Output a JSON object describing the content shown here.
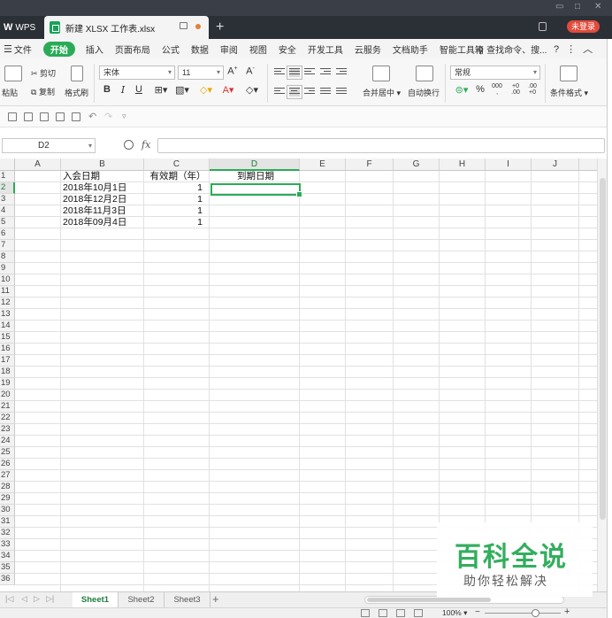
{
  "titlebar": {
    "app_label": "WPS",
    "doc_tab_title": "新建 XLSX 工作表.xlsx",
    "login_label": "未登录"
  },
  "menu": {
    "file": "文件",
    "items": [
      "开始",
      "插入",
      "页面布局",
      "公式",
      "数据",
      "审阅",
      "视图",
      "安全",
      "开发工具",
      "云服务",
      "文档助手",
      "智能工具箱"
    ],
    "search": "查找命令、搜..."
  },
  "ribbon": {
    "paste": "粘贴",
    "cut": "剪切",
    "copy": "复制",
    "format_painter": "格式刷",
    "font_name": "宋体",
    "font_size": "11",
    "merge": "合并居中",
    "wrap": "自动换行",
    "number_format": "常规",
    "cond_format": "条件格式"
  },
  "formula_bar": {
    "name_box": "D2",
    "fx": "fx",
    "formula": ""
  },
  "grid": {
    "columns": [
      "A",
      "B",
      "C",
      "D",
      "E",
      "F",
      "G",
      "H",
      "I",
      "J"
    ],
    "selected_col": "D",
    "selected_row": 2,
    "row_count": 36,
    "cells": {
      "B1": "入会日期",
      "C1": "有效期（年）",
      "D1": "到期日期",
      "B2": "2018年10月1日",
      "B3": "2018年12月2日",
      "B4": "2018年11月3日",
      "B5": "2018年09月4日",
      "C2": "1",
      "C3": "1",
      "C4": "1",
      "C5": "1"
    }
  },
  "sheets": {
    "tabs": [
      "Sheet1",
      "Sheet2",
      "Sheet3"
    ],
    "active": "Sheet1"
  },
  "status": {
    "zoom": "100%"
  },
  "watermark": {
    "title": "百科全说",
    "subtitle": "助你轻松解决"
  }
}
